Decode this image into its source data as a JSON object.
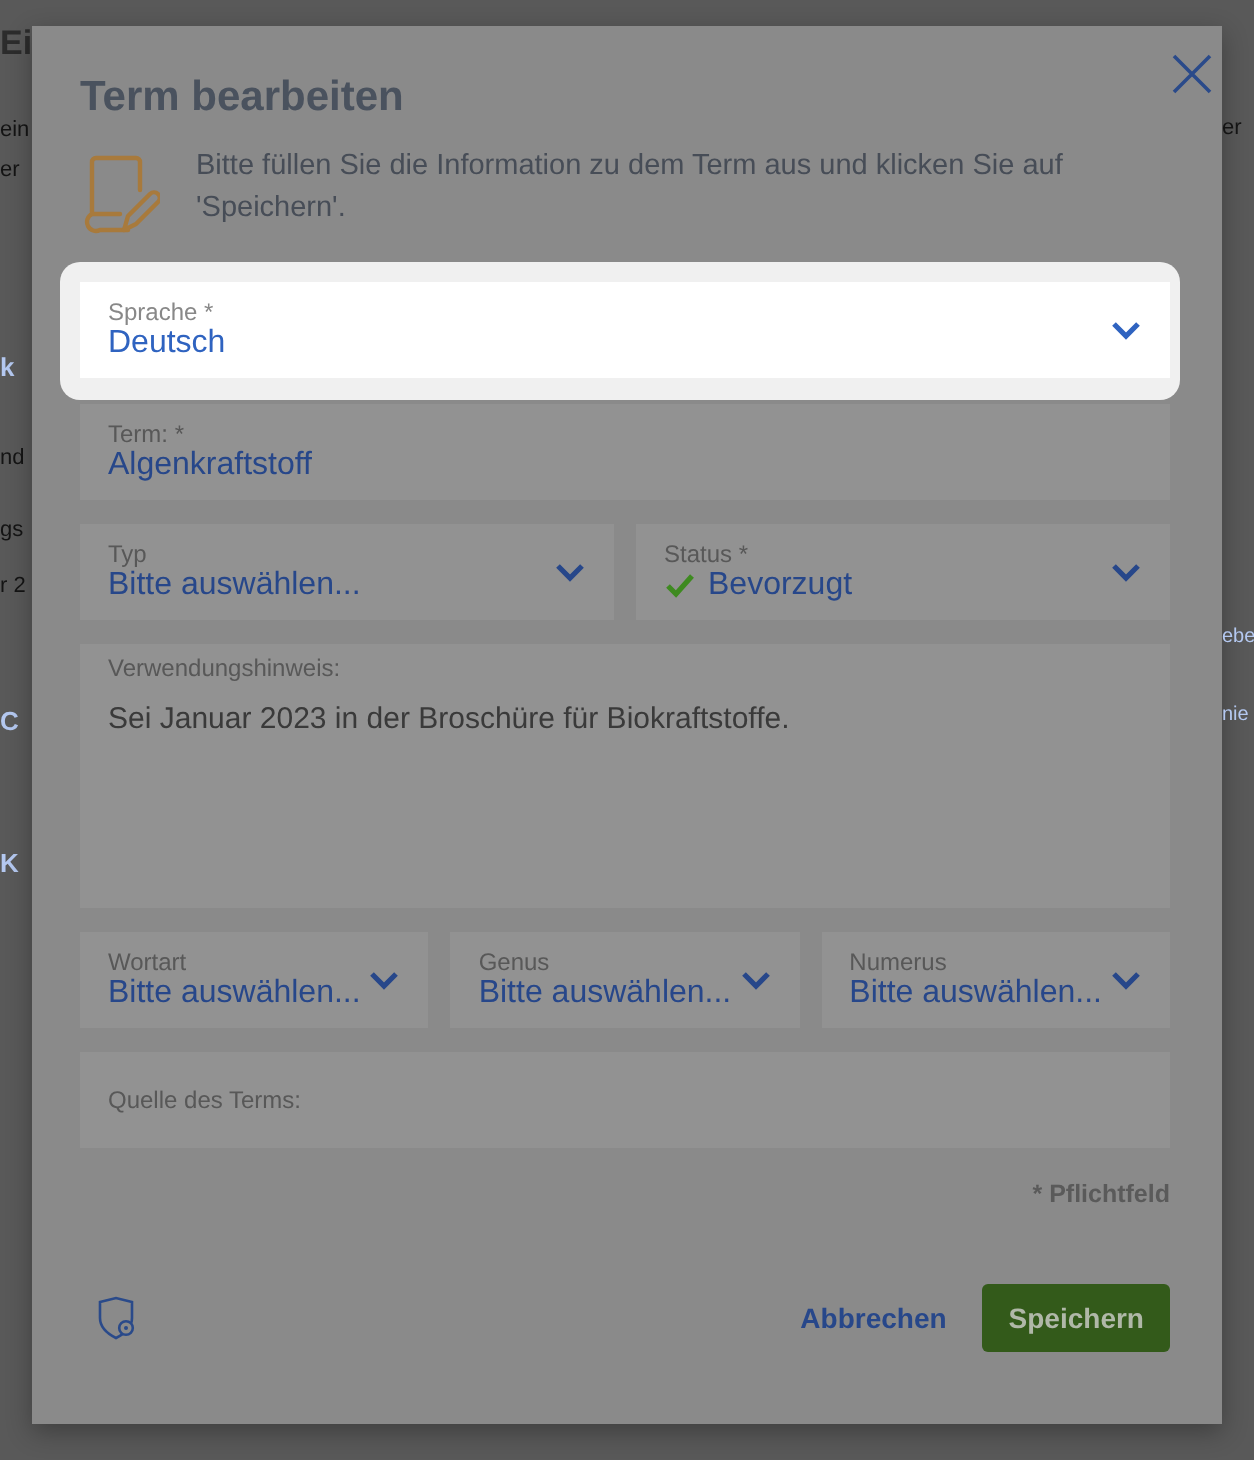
{
  "background": {
    "left": [
      {
        "text": "Ei",
        "kind": "heading"
      },
      {
        "text": "ein",
        "kind": "text"
      },
      {
        "text": "er",
        "kind": "text"
      },
      {
        "text": "k",
        "kind": "link"
      },
      {
        "text": "nd",
        "kind": "text"
      },
      {
        "text": "gs",
        "kind": "text"
      },
      {
        "text": "r 2",
        "kind": "text"
      },
      {
        "text": "C",
        "kind": "link"
      },
      {
        "text": "K",
        "kind": "link"
      }
    ],
    "right": [
      {
        "text": "er",
        "kind": "text"
      },
      {
        "text": "ebe",
        "kind": "link"
      },
      {
        "text": "nie",
        "kind": "link"
      }
    ]
  },
  "dialog": {
    "title": "Term bearbeiten",
    "description": "Bitte füllen Sie die Information zu dem Term aus und klicken Sie auf 'Speichern'.",
    "rows": [
      [
        {
          "kind": "select",
          "label": "Sprache *",
          "value": "Deutsch",
          "highlighted": true,
          "check": false
        }
      ],
      [
        {
          "kind": "text",
          "label": "Term: *",
          "value": "Algenkraftstoff",
          "highlighted": false,
          "check": false
        }
      ],
      [
        {
          "kind": "select",
          "label": "Typ",
          "value": "Bitte auswählen...",
          "highlighted": false,
          "check": false
        },
        {
          "kind": "select",
          "label": "Status *",
          "value": "Bevorzugt",
          "highlighted": false,
          "check": true
        }
      ],
      [
        {
          "kind": "textarea",
          "label": "Verwendungshinweis:",
          "value": "Sei Januar 2023 in der Broschüre für Biokraftstoffe.",
          "highlighted": false,
          "check": false
        }
      ],
      [
        {
          "kind": "select",
          "label": "Wortart",
          "value": "Bitte auswählen...",
          "highlighted": false,
          "check": false
        },
        {
          "kind": "select",
          "label": "Genus",
          "value": "Bitte auswählen...",
          "highlighted": false,
          "check": false
        },
        {
          "kind": "select",
          "label": "Numerus",
          "value": "Bitte auswählen...",
          "highlighted": false,
          "check": false
        }
      ],
      [
        {
          "kind": "text",
          "label": "Quelle des Terms:",
          "highlighted": false,
          "check": false
        }
      ]
    ],
    "required_note": "* Pflichtfeld",
    "cancel": "Abbrechen",
    "save": "Speichern"
  }
}
